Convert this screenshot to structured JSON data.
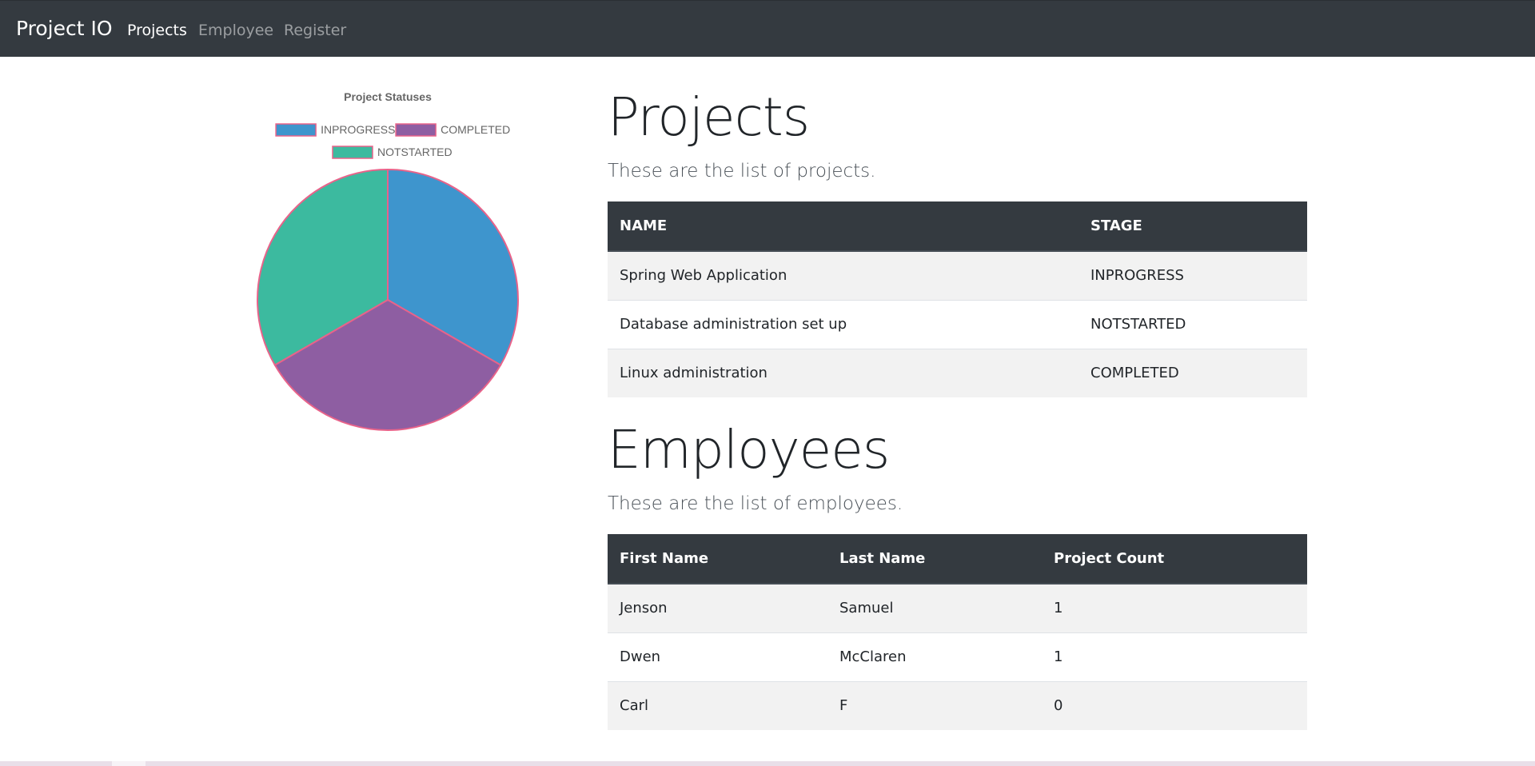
{
  "navbar": {
    "brand": "Project IO",
    "links": [
      {
        "label": "Projects",
        "active": true
      },
      {
        "label": "Employee",
        "active": false
      },
      {
        "label": "Register",
        "active": false
      }
    ]
  },
  "chart_data": {
    "type": "pie",
    "title": "Project Statuses",
    "legend_position": "top",
    "categories": [
      "INPROGRESS",
      "COMPLETED",
      "NOTSTARTED"
    ],
    "values": [
      1,
      1,
      1
    ],
    "colors": [
      "#3e95cd",
      "#8e5ea2",
      "#3cba9f"
    ],
    "border_color": "#e8638a"
  },
  "projects": {
    "heading": "Projects",
    "subtitle": "These are the list of projects.",
    "columns": [
      "NAME",
      "STAGE"
    ],
    "rows": [
      [
        "Spring Web Application",
        "INPROGRESS"
      ],
      [
        "Database administration set up",
        "NOTSTARTED"
      ],
      [
        "Linux administration",
        "COMPLETED"
      ]
    ]
  },
  "employees": {
    "heading": "Employees",
    "subtitle": "These are the list of employees.",
    "columns": [
      "First Name",
      "Last Name",
      "Project Count"
    ],
    "rows": [
      [
        "Jenson",
        "Samuel",
        "1"
      ],
      [
        "Dwen",
        "McClaren",
        "1"
      ],
      [
        "Carl",
        "F",
        "0"
      ]
    ]
  }
}
